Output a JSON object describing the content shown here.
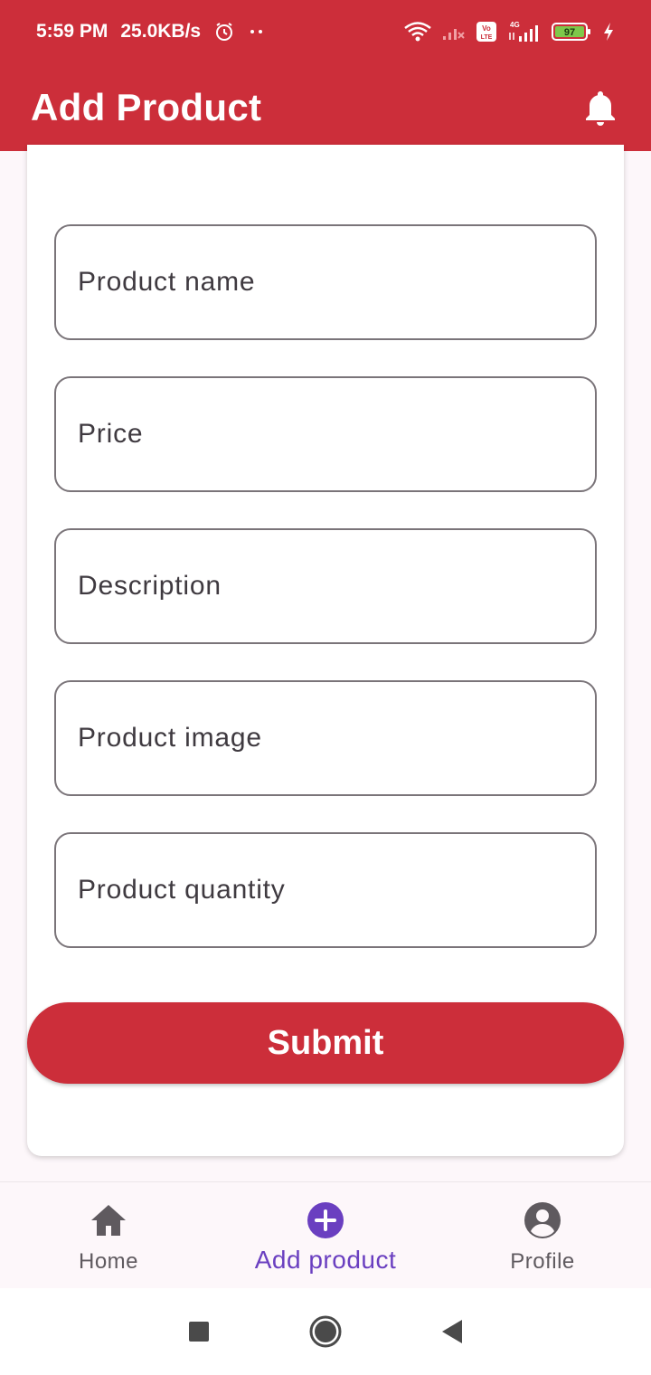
{
  "status_bar": {
    "time": "5:59 PM",
    "speed": "25.0KB/s",
    "battery": "97",
    "network_label": "4G",
    "volte_label": "Vo LTE"
  },
  "app_bar": {
    "title": "Add Product",
    "icon": "bell-icon"
  },
  "form": {
    "fields": [
      {
        "placeholder": "Product name"
      },
      {
        "placeholder": "Price"
      },
      {
        "placeholder": "Description"
      },
      {
        "placeholder": "Product image"
      },
      {
        "placeholder": "Product quantity"
      }
    ],
    "submit_label": "Submit"
  },
  "bottom_nav": {
    "items": [
      {
        "label": "Home",
        "icon": "home-icon",
        "active": false
      },
      {
        "label": "Add product",
        "icon": "add-circle-icon",
        "active": true
      },
      {
        "label": "Profile",
        "icon": "account-circle-icon",
        "active": false
      }
    ]
  },
  "colors": {
    "primary": "#cc2e3a",
    "active_nav": "#6a3fc0",
    "inactive_nav": "#5f5a5f"
  }
}
